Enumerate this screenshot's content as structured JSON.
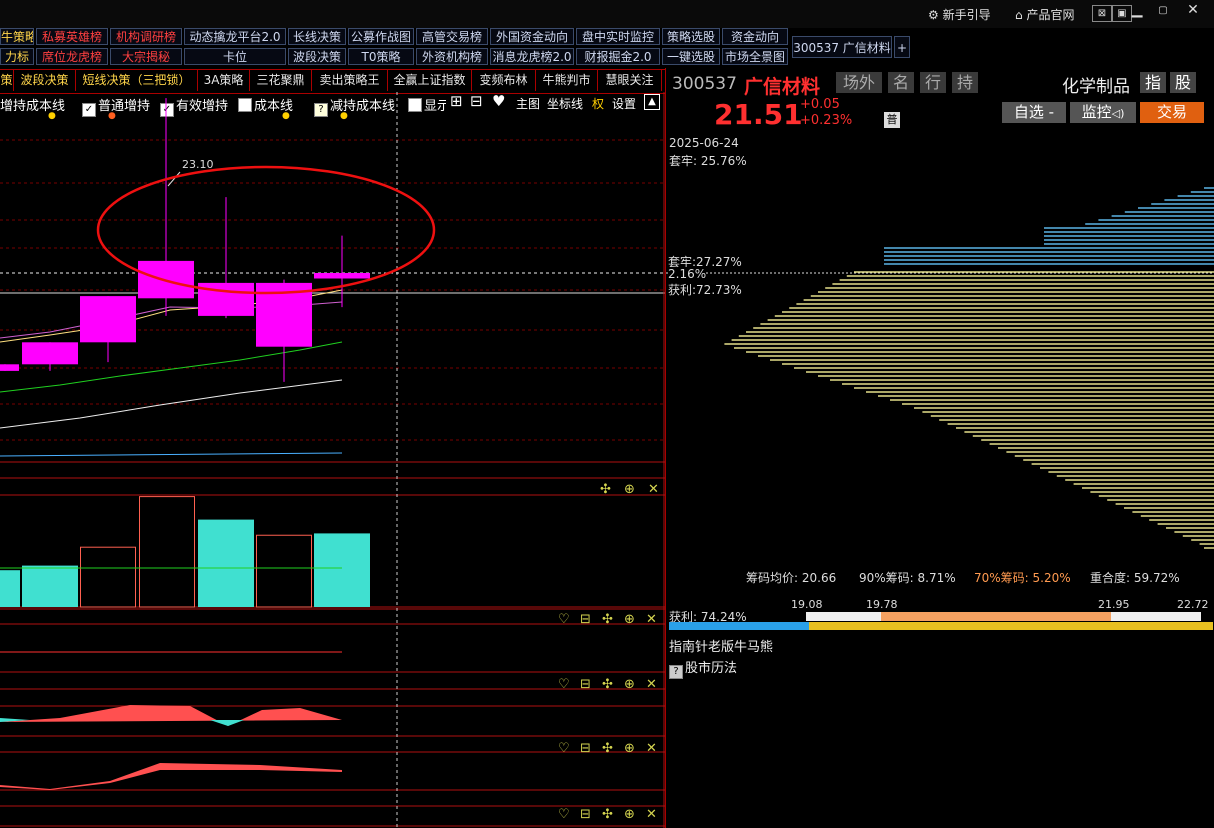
{
  "titlebar": {
    "guide": "新手引导",
    "website": "产品官网"
  },
  "grid": {
    "row1": [
      "牛策略",
      "私募英雄榜",
      "机构调研榜",
      "动态擒龙平台2.0",
      "长线决策",
      "公募作战图",
      "高管交易榜",
      "外国资金动向",
      "盘中实时监控",
      "策略选股",
      "资金动向"
    ],
    "row2": [
      "力标",
      "席位龙虎榜",
      "大宗揭秘",
      "卡位",
      "波段决策",
      "T0策略",
      "外资机构榜",
      "消息龙虎榜2.0",
      "财报掘金2.0",
      "一键选股",
      "市场全景图"
    ],
    "stock_tab": "300537 广信材料",
    "plus": "+"
  },
  "tabs": [
    "策",
    "波段决策",
    "短线决策（三把锁）",
    "3A策略",
    "三花聚鼎",
    "卖出策略王",
    "全赢上证指数",
    "变频布林",
    "牛熊判市",
    "慧眼关注"
  ],
  "indicators": {
    "items": [
      "增持成本线",
      "普通增持",
      "有效增持",
      "成本线",
      "减持成本线",
      "显示"
    ],
    "main_chart": "主图",
    "axis_line": "坐标线",
    "rights": "权",
    "settings": "设置"
  },
  "chart": {
    "high_label": "23.10",
    "candles": [
      {
        "open": 20.62,
        "close": 20.68,
        "high": 20.68,
        "low": 20.62
      },
      {
        "open": 20.68,
        "close": 20.88,
        "high": 20.88,
        "low": 20.62
      },
      {
        "open": 20.88,
        "close": 21.3,
        "high": 21.3,
        "low": 20.7
      },
      {
        "open": 21.28,
        "close": 21.62,
        "high": 23.1,
        "low": 21.12
      },
      {
        "open": 21.42,
        "close": 21.12,
        "high": 22.2,
        "low": 21.1
      },
      {
        "open": 21.42,
        "close": 20.84,
        "high": 21.45,
        "low": 20.52
      },
      {
        "open": 21.46,
        "close": 21.51,
        "high": 21.85,
        "low": 21.2
      }
    ],
    "volume": [
      40,
      45,
      65,
      120,
      95,
      78,
      80
    ],
    "volume_down": [
      false,
      false,
      true,
      true,
      false,
      true,
      false
    ]
  },
  "quote": {
    "code": "300537",
    "name": "广信材料",
    "price": "21.51",
    "change": "+0.05",
    "change_pct": "+0.23%",
    "badge": "普",
    "tags": [
      "场外",
      "名",
      "行",
      "持"
    ],
    "industry": "化学制品",
    "ind_btns": [
      "指",
      "股"
    ],
    "watch": "自选 -",
    "monitor": "监控",
    "trade": "交易"
  },
  "chips": {
    "date": "2025-06-24",
    "trapped_top": "套牢: 25.76%",
    "trapped": "套牢:27.27%",
    "mid": "2.16%",
    "profit_label": "获利:72.73%",
    "avg": "筹码均价: 20.66",
    "c90": "90%筹码: 8.71%",
    "c70": "70%筹码: 5.20%",
    "overlap": "重合度: 59.72%",
    "profit2": "获利: 74.24%",
    "scale": [
      "19.08",
      "19.78",
      "21.95",
      "22.72"
    ]
  },
  "links": [
    "指南针老版牛马熊",
    "股市历法"
  ],
  "colors": {
    "up": "#ff00ff",
    "down_vol": "#40e0d0",
    "price_red": "#ff3030",
    "chip_yellow": "#e6e08a",
    "chip_blue": "#5ab4e6"
  }
}
